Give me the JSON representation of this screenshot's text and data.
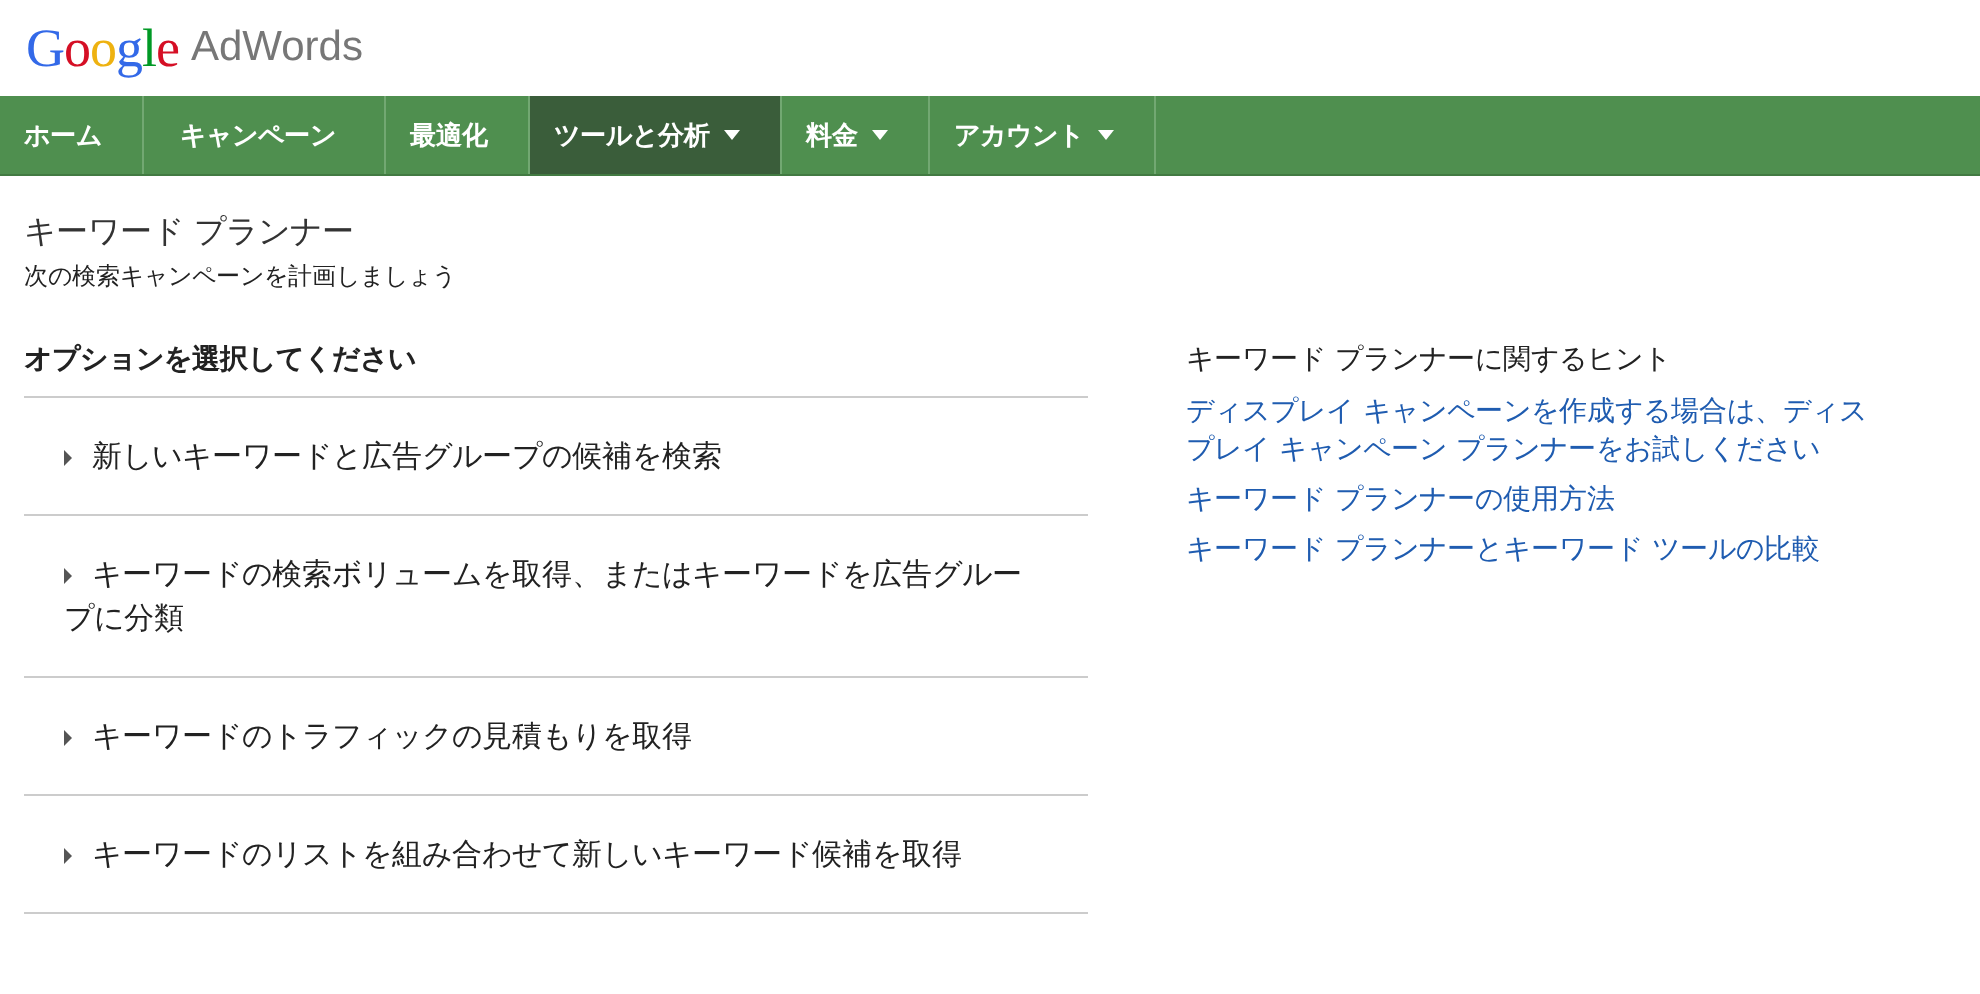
{
  "header": {
    "brand": "Google",
    "product": "AdWords"
  },
  "nav": [
    {
      "label": "ホーム",
      "selected": false,
      "has_menu": false
    },
    {
      "label": "キャンペーン",
      "selected": false,
      "has_menu": false
    },
    {
      "label": "最適化",
      "selected": false,
      "has_menu": false
    },
    {
      "label": "ツールと分析",
      "selected": true,
      "has_menu": true
    },
    {
      "label": "料金",
      "selected": false,
      "has_menu": true
    },
    {
      "label": "アカウント",
      "selected": false,
      "has_menu": true
    }
  ],
  "page": {
    "title": "キーワード プランナー",
    "subtitle": "次の検索キャンペーンを計画しましょう"
  },
  "options": {
    "heading": "オプションを選択してください",
    "items": [
      {
        "label": "新しいキーワードと広告グループの候補を検索",
        "expanded": false
      },
      {
        "label": "キーワードの検索ボリュームを取得、またはキーワードを広告グループに分類",
        "expanded": false
      },
      {
        "label": "キーワードのトラフィックの見積もりを取得",
        "expanded": false
      },
      {
        "label": "キーワードのリストを組み合わせて新しいキーワード候補を取得",
        "expanded": false
      }
    ]
  },
  "tips": {
    "heading": "キーワード プランナーに関するヒント",
    "links": [
      "ディスプレイ キャンペーンを作成する場合は、ディスプレイ キャンペーン プランナーをお試しください",
      "キーワード プランナーの使用方法",
      "キーワード プランナーとキーワード ツールの比較"
    ]
  }
}
